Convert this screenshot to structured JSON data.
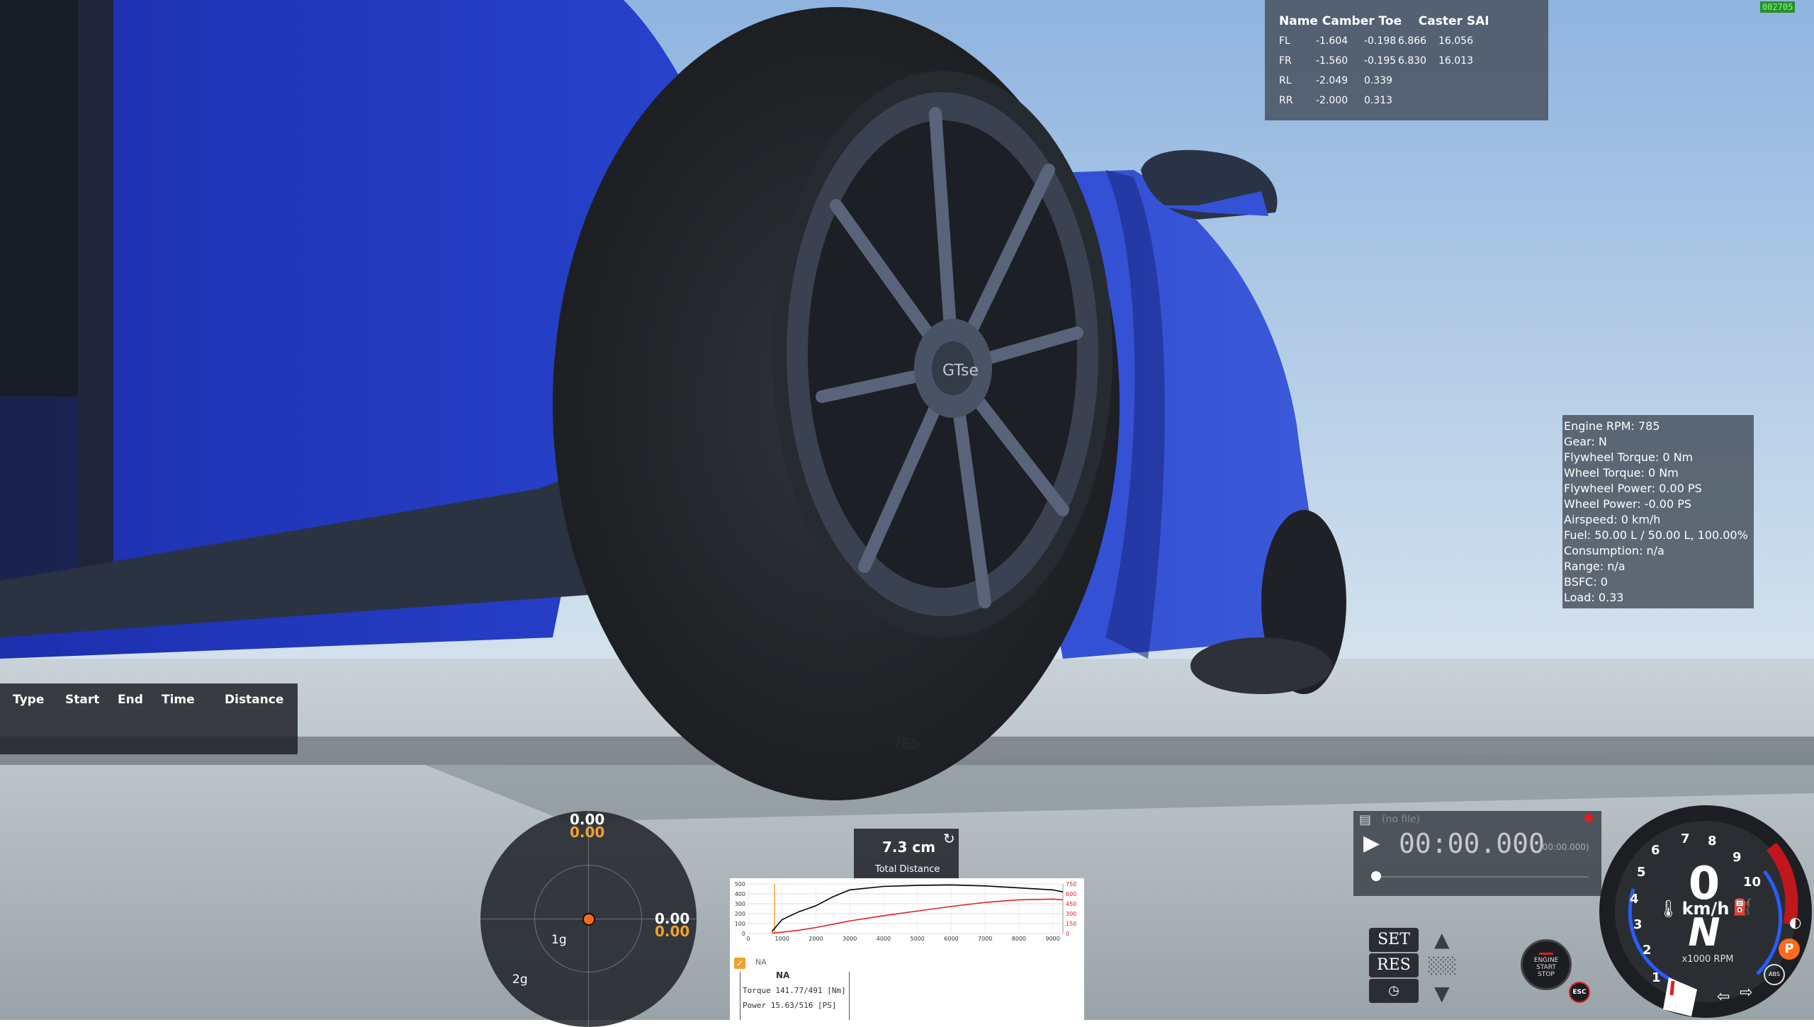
{
  "fps": "002705",
  "alignment": {
    "headers": [
      "Name",
      "Camber",
      "Toe",
      "Caster",
      "SAI"
    ],
    "rows": [
      {
        "name": "FL",
        "camber": "-1.604",
        "toe": "-0.198",
        "caster": "6.866",
        "sai": "16.056"
      },
      {
        "name": "FR",
        "camber": "-1.560",
        "toe": "-0.195",
        "caster": "6.830",
        "sai": "16.013"
      },
      {
        "name": "RL",
        "camber": "-2.049",
        "toe": "0.339",
        "caster": "",
        "sai": ""
      },
      {
        "name": "RR",
        "camber": "-2.000",
        "toe": "0.313",
        "caster": "",
        "sai": ""
      }
    ]
  },
  "engine": [
    "Engine RPM: 785",
    "Gear: N",
    "Flywheel Torque: 0 Nm",
    "Wheel Torque: 0 Nm",
    "Flywheel Power: 0.00 PS",
    "Wheel Power: -0.00 PS",
    "Airspeed: 0 km/h",
    "Fuel: 50.00 L / 50.00 L, 100.00%",
    "Consumption: n/a",
    "Range: n/a",
    "BSFC: 0",
    "Load: 0.33"
  ],
  "drag": {
    "headers": [
      "Type",
      "Start",
      "End",
      "Time",
      "Distance"
    ]
  },
  "road_text": "785",
  "gmeter": {
    "top_white": "0.00",
    "top_orange": "0.00",
    "right_white": "0.00",
    "right_orange": "0.00",
    "ring1": "1g",
    "ring2": "2g"
  },
  "distance": {
    "value": "7.3 cm",
    "label": "Total Distance"
  },
  "graph": {
    "left_ticks": [
      "500",
      "400",
      "300",
      "200",
      "100",
      "0"
    ],
    "right_ticks": [
      "750",
      "600",
      "450",
      "300",
      "150",
      "0"
    ],
    "x_ticks": [
      "0",
      "1000",
      "2000",
      "3000",
      "4000",
      "5000",
      "6000",
      "7000",
      "8000",
      "9000"
    ],
    "checkbox_label": "NA",
    "name": "NA",
    "torque_label": "Torque",
    "torque_value": "141.77/491 [Nm]",
    "power_label": "Power",
    "power_value": "15.63/516 [PS]",
    "colors": {
      "torque": "#000000",
      "power": "#e02020",
      "marker": "#f0a030"
    }
  },
  "chart_data": {
    "type": "line",
    "x": [
      700,
      1000,
      1500,
      2000,
      2500,
      3000,
      4000,
      5000,
      6000,
      7000,
      8000,
      9000,
      9300
    ],
    "series": [
      {
        "name": "Torque",
        "values": [
          20,
          140,
          220,
          280,
          370,
          440,
          475,
          485,
          490,
          480,
          460,
          440,
          420
        ]
      },
      {
        "name": "Power",
        "values": [
          5,
          20,
          50,
          90,
          140,
          190,
          270,
          340,
          410,
          470,
          510,
          520,
          510
        ]
      }
    ],
    "xlim": [
      0,
      9300
    ],
    "ylim_left": [
      0,
      500
    ],
    "ylim_right": [
      0,
      750
    ]
  },
  "replay": {
    "file": "(no file)",
    "time": "00:00.000",
    "subtime": "(00:00.000)"
  },
  "cruise": {
    "set": "SET",
    "res": "RES"
  },
  "engine_button": {
    "line1": "ENGINE",
    "line2": "START",
    "line3": "STOP"
  },
  "esc_label": "ESC",
  "gauge": {
    "speed": "0",
    "unit": "km/h",
    "gear": "N",
    "rpm_label": "x1000 RPM",
    "ticks": [
      "1",
      "2",
      "3",
      "4",
      "5",
      "6",
      "7",
      "8",
      "9",
      "10"
    ],
    "park": "P",
    "abs": "ABS"
  }
}
